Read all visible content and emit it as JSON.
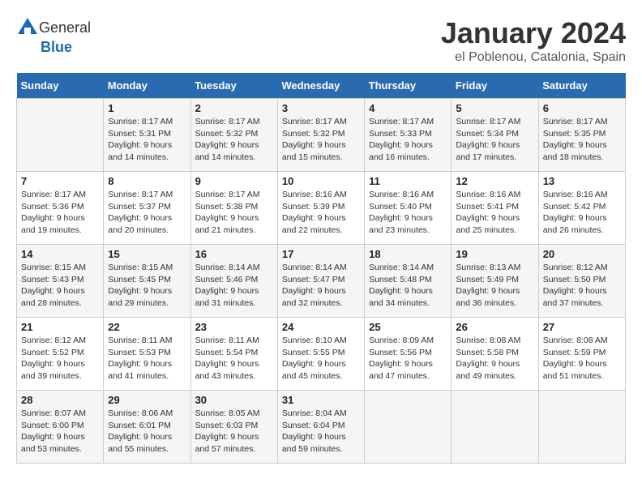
{
  "header": {
    "logo_general": "General",
    "logo_blue": "Blue",
    "month_title": "January 2024",
    "location": "el Poblenou, Catalonia, Spain"
  },
  "days_of_week": [
    "Sunday",
    "Monday",
    "Tuesday",
    "Wednesday",
    "Thursday",
    "Friday",
    "Saturday"
  ],
  "weeks": [
    [
      {
        "day": "",
        "sunrise": "",
        "sunset": "",
        "daylight": ""
      },
      {
        "day": "1",
        "sunrise": "Sunrise: 8:17 AM",
        "sunset": "Sunset: 5:31 PM",
        "daylight": "Daylight: 9 hours and 14 minutes."
      },
      {
        "day": "2",
        "sunrise": "Sunrise: 8:17 AM",
        "sunset": "Sunset: 5:32 PM",
        "daylight": "Daylight: 9 hours and 14 minutes."
      },
      {
        "day": "3",
        "sunrise": "Sunrise: 8:17 AM",
        "sunset": "Sunset: 5:32 PM",
        "daylight": "Daylight: 9 hours and 15 minutes."
      },
      {
        "day": "4",
        "sunrise": "Sunrise: 8:17 AM",
        "sunset": "Sunset: 5:33 PM",
        "daylight": "Daylight: 9 hours and 16 minutes."
      },
      {
        "day": "5",
        "sunrise": "Sunrise: 8:17 AM",
        "sunset": "Sunset: 5:34 PM",
        "daylight": "Daylight: 9 hours and 17 minutes."
      },
      {
        "day": "6",
        "sunrise": "Sunrise: 8:17 AM",
        "sunset": "Sunset: 5:35 PM",
        "daylight": "Daylight: 9 hours and 18 minutes."
      }
    ],
    [
      {
        "day": "7",
        "sunrise": "Sunrise: 8:17 AM",
        "sunset": "Sunset: 5:36 PM",
        "daylight": "Daylight: 9 hours and 19 minutes."
      },
      {
        "day": "8",
        "sunrise": "Sunrise: 8:17 AM",
        "sunset": "Sunset: 5:37 PM",
        "daylight": "Daylight: 9 hours and 20 minutes."
      },
      {
        "day": "9",
        "sunrise": "Sunrise: 8:17 AM",
        "sunset": "Sunset: 5:38 PM",
        "daylight": "Daylight: 9 hours and 21 minutes."
      },
      {
        "day": "10",
        "sunrise": "Sunrise: 8:16 AM",
        "sunset": "Sunset: 5:39 PM",
        "daylight": "Daylight: 9 hours and 22 minutes."
      },
      {
        "day": "11",
        "sunrise": "Sunrise: 8:16 AM",
        "sunset": "Sunset: 5:40 PM",
        "daylight": "Daylight: 9 hours and 23 minutes."
      },
      {
        "day": "12",
        "sunrise": "Sunrise: 8:16 AM",
        "sunset": "Sunset: 5:41 PM",
        "daylight": "Daylight: 9 hours and 25 minutes."
      },
      {
        "day": "13",
        "sunrise": "Sunrise: 8:16 AM",
        "sunset": "Sunset: 5:42 PM",
        "daylight": "Daylight: 9 hours and 26 minutes."
      }
    ],
    [
      {
        "day": "14",
        "sunrise": "Sunrise: 8:15 AM",
        "sunset": "Sunset: 5:43 PM",
        "daylight": "Daylight: 9 hours and 28 minutes."
      },
      {
        "day": "15",
        "sunrise": "Sunrise: 8:15 AM",
        "sunset": "Sunset: 5:45 PM",
        "daylight": "Daylight: 9 hours and 29 minutes."
      },
      {
        "day": "16",
        "sunrise": "Sunrise: 8:14 AM",
        "sunset": "Sunset: 5:46 PM",
        "daylight": "Daylight: 9 hours and 31 minutes."
      },
      {
        "day": "17",
        "sunrise": "Sunrise: 8:14 AM",
        "sunset": "Sunset: 5:47 PM",
        "daylight": "Daylight: 9 hours and 32 minutes."
      },
      {
        "day": "18",
        "sunrise": "Sunrise: 8:14 AM",
        "sunset": "Sunset: 5:48 PM",
        "daylight": "Daylight: 9 hours and 34 minutes."
      },
      {
        "day": "19",
        "sunrise": "Sunrise: 8:13 AM",
        "sunset": "Sunset: 5:49 PM",
        "daylight": "Daylight: 9 hours and 36 minutes."
      },
      {
        "day": "20",
        "sunrise": "Sunrise: 8:12 AM",
        "sunset": "Sunset: 5:50 PM",
        "daylight": "Daylight: 9 hours and 37 minutes."
      }
    ],
    [
      {
        "day": "21",
        "sunrise": "Sunrise: 8:12 AM",
        "sunset": "Sunset: 5:52 PM",
        "daylight": "Daylight: 9 hours and 39 minutes."
      },
      {
        "day": "22",
        "sunrise": "Sunrise: 8:11 AM",
        "sunset": "Sunset: 5:53 PM",
        "daylight": "Daylight: 9 hours and 41 minutes."
      },
      {
        "day": "23",
        "sunrise": "Sunrise: 8:11 AM",
        "sunset": "Sunset: 5:54 PM",
        "daylight": "Daylight: 9 hours and 43 minutes."
      },
      {
        "day": "24",
        "sunrise": "Sunrise: 8:10 AM",
        "sunset": "Sunset: 5:55 PM",
        "daylight": "Daylight: 9 hours and 45 minutes."
      },
      {
        "day": "25",
        "sunrise": "Sunrise: 8:09 AM",
        "sunset": "Sunset: 5:56 PM",
        "daylight": "Daylight: 9 hours and 47 minutes."
      },
      {
        "day": "26",
        "sunrise": "Sunrise: 8:08 AM",
        "sunset": "Sunset: 5:58 PM",
        "daylight": "Daylight: 9 hours and 49 minutes."
      },
      {
        "day": "27",
        "sunrise": "Sunrise: 8:08 AM",
        "sunset": "Sunset: 5:59 PM",
        "daylight": "Daylight: 9 hours and 51 minutes."
      }
    ],
    [
      {
        "day": "28",
        "sunrise": "Sunrise: 8:07 AM",
        "sunset": "Sunset: 6:00 PM",
        "daylight": "Daylight: 9 hours and 53 minutes."
      },
      {
        "day": "29",
        "sunrise": "Sunrise: 8:06 AM",
        "sunset": "Sunset: 6:01 PM",
        "daylight": "Daylight: 9 hours and 55 minutes."
      },
      {
        "day": "30",
        "sunrise": "Sunrise: 8:05 AM",
        "sunset": "Sunset: 6:03 PM",
        "daylight": "Daylight: 9 hours and 57 minutes."
      },
      {
        "day": "31",
        "sunrise": "Sunrise: 8:04 AM",
        "sunset": "Sunset: 6:04 PM",
        "daylight": "Daylight: 9 hours and 59 minutes."
      },
      {
        "day": "",
        "sunrise": "",
        "sunset": "",
        "daylight": ""
      },
      {
        "day": "",
        "sunrise": "",
        "sunset": "",
        "daylight": ""
      },
      {
        "day": "",
        "sunrise": "",
        "sunset": "",
        "daylight": ""
      }
    ]
  ]
}
